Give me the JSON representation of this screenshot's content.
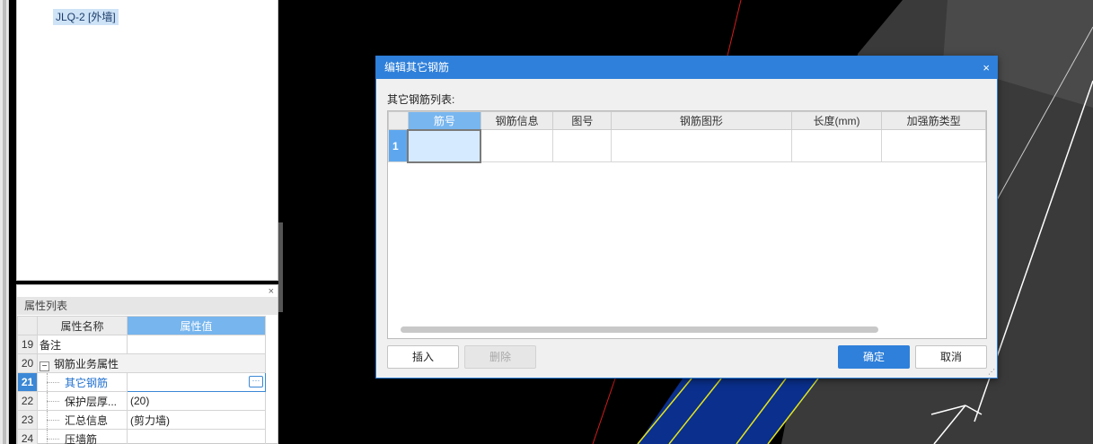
{
  "tree": {
    "selected_node": "JLQ-2 [外墙]"
  },
  "properties": {
    "panel_title": "属性列表",
    "close_glyph": "×",
    "header_name": "属性名称",
    "header_value": "属性值",
    "rows": [
      {
        "num": "19",
        "name": "备注",
        "value": ""
      },
      {
        "num": "20",
        "name": "钢筋业务属性",
        "value": "",
        "collapse": "−"
      },
      {
        "num": "21",
        "name": "其它钢筋",
        "value": "",
        "edit_button": "···"
      },
      {
        "num": "22",
        "name": "保护层厚...",
        "value": "(20)"
      },
      {
        "num": "23",
        "name": "汇总信息",
        "value": "(剪力墙)"
      },
      {
        "num": "24",
        "name": "压墙筋",
        "value": ""
      }
    ]
  },
  "dialog": {
    "title": "编辑其它钢筋",
    "close_glyph": "×",
    "list_label": "其它钢筋列表:",
    "columns": [
      "筋号",
      "钢筋信息",
      "图号",
      "钢筋图形",
      "长度(mm)",
      "加强筋类型"
    ],
    "rows": [
      {
        "num": "1",
        "cells": [
          "",
          "",
          "",
          "",
          "",
          ""
        ]
      }
    ],
    "buttons": {
      "insert": "插入",
      "delete": "删除",
      "ok": "确定",
      "cancel": "取消"
    },
    "resize_glyph": "⋰"
  },
  "colors": {
    "accent": "#2f80da",
    "header_active": "#78b6ef",
    "canvas_bg": "#000000",
    "cad_blue": "#0a2f8c",
    "cad_yellow": "#e5e51a",
    "cad_red": "#d41c1c"
  }
}
